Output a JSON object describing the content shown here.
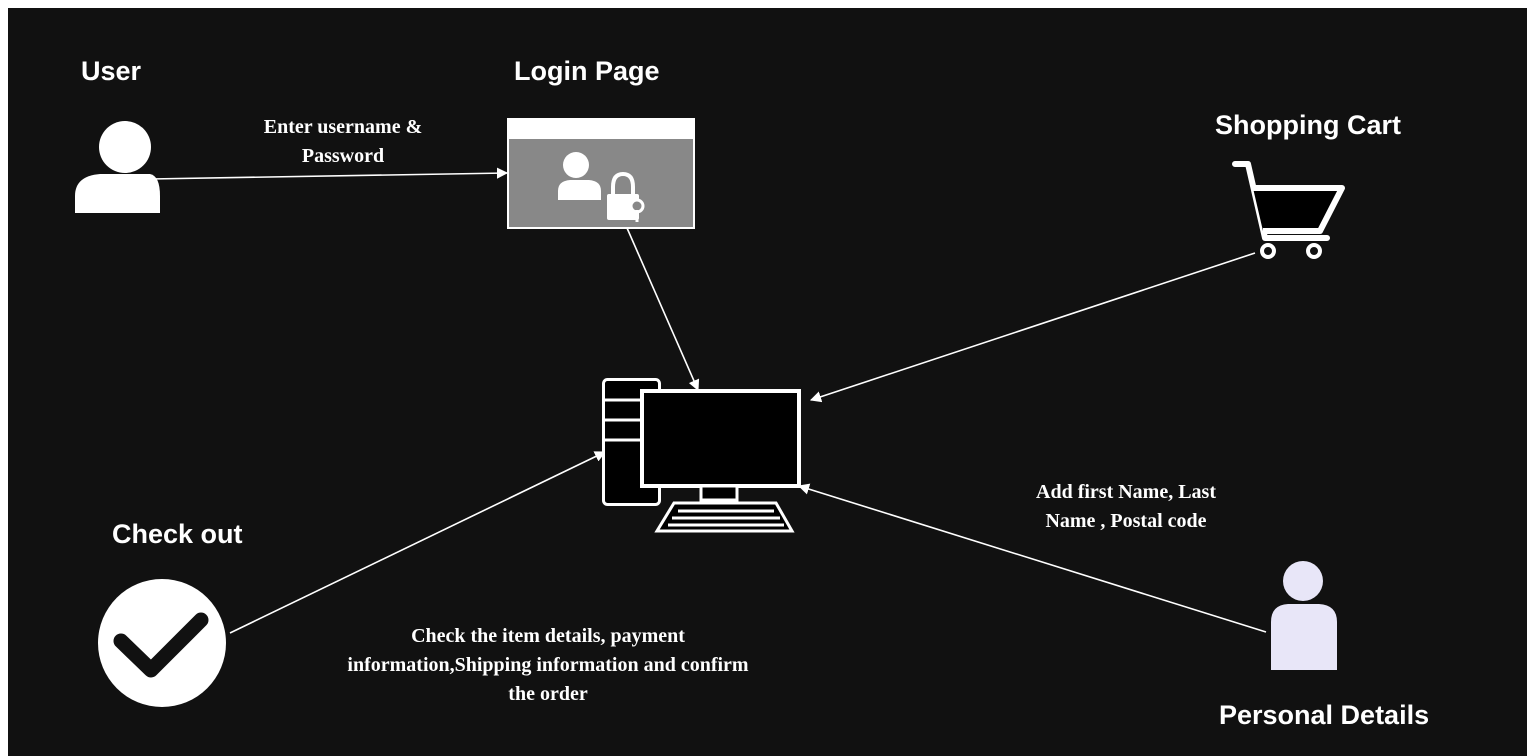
{
  "nodes": {
    "user": {
      "label": "User",
      "icon": "user-icon"
    },
    "login_page": {
      "label": "Login Page",
      "icon": "login-window-icon"
    },
    "shopping_cart": {
      "label": "Shopping Cart",
      "icon": "shopping-cart-icon"
    },
    "computer": {
      "icon": "desktop-computer-icon"
    },
    "check_out": {
      "label": "Check out",
      "icon": "checkmark-circle-icon"
    },
    "personal_details": {
      "label": "Personal Details",
      "icon": "person-icon"
    }
  },
  "edges": {
    "user_to_login": {
      "label_lines": [
        "Enter username  &",
        "Password"
      ]
    },
    "login_to_computer": {},
    "cart_to_computer": {},
    "details_to_computer": {
      "label_lines": [
        "Add first Name, Last",
        "Name , Postal code"
      ]
    },
    "checkout_to_computer": {
      "label_lines": [
        "Check the item details, payment",
        "information,Shipping information and confirm",
        "the order"
      ]
    }
  },
  "colors": {
    "background": "#111111",
    "foreground": "#ffffff",
    "login_window_body": "#888888",
    "person_fill": "#e8e6f8"
  }
}
